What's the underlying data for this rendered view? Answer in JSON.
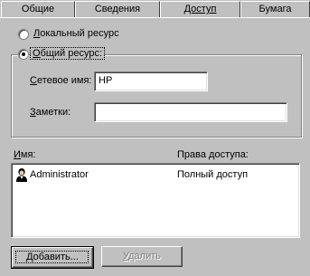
{
  "tabs": [
    {
      "label": "Общие",
      "active": false
    },
    {
      "label": "Сведения",
      "active": false
    },
    {
      "label": "Доступ",
      "active": true
    },
    {
      "label": "Бумага",
      "active": false
    }
  ],
  "sharing": {
    "local_label": "Локальный ресурс",
    "local_mnemonic": "Л",
    "local_rest": "окальный ресурс",
    "shared_label": "Общий ресурс:",
    "shared_mnemonic": "О",
    "shared_rest": "бщий ресурс:",
    "selected": "shared"
  },
  "fields": {
    "share_name_label_mn": "С",
    "share_name_label_rest": "етевое имя:",
    "share_name_value": "HP",
    "comment_label_mn": "З",
    "comment_label_rest": "аметки:",
    "comment_value": ""
  },
  "permissions": {
    "col_name_mn": "И",
    "col_name_rest": "мя:",
    "col_rights": "Права доступа:",
    "rows": [
      {
        "name": "Administrator",
        "rights": "Полный доступ",
        "icon": "user-icon"
      }
    ]
  },
  "buttons": {
    "add_mn": "Д",
    "add_rest": "обавить...",
    "remove_mn": "У",
    "remove_rest": "далить"
  }
}
